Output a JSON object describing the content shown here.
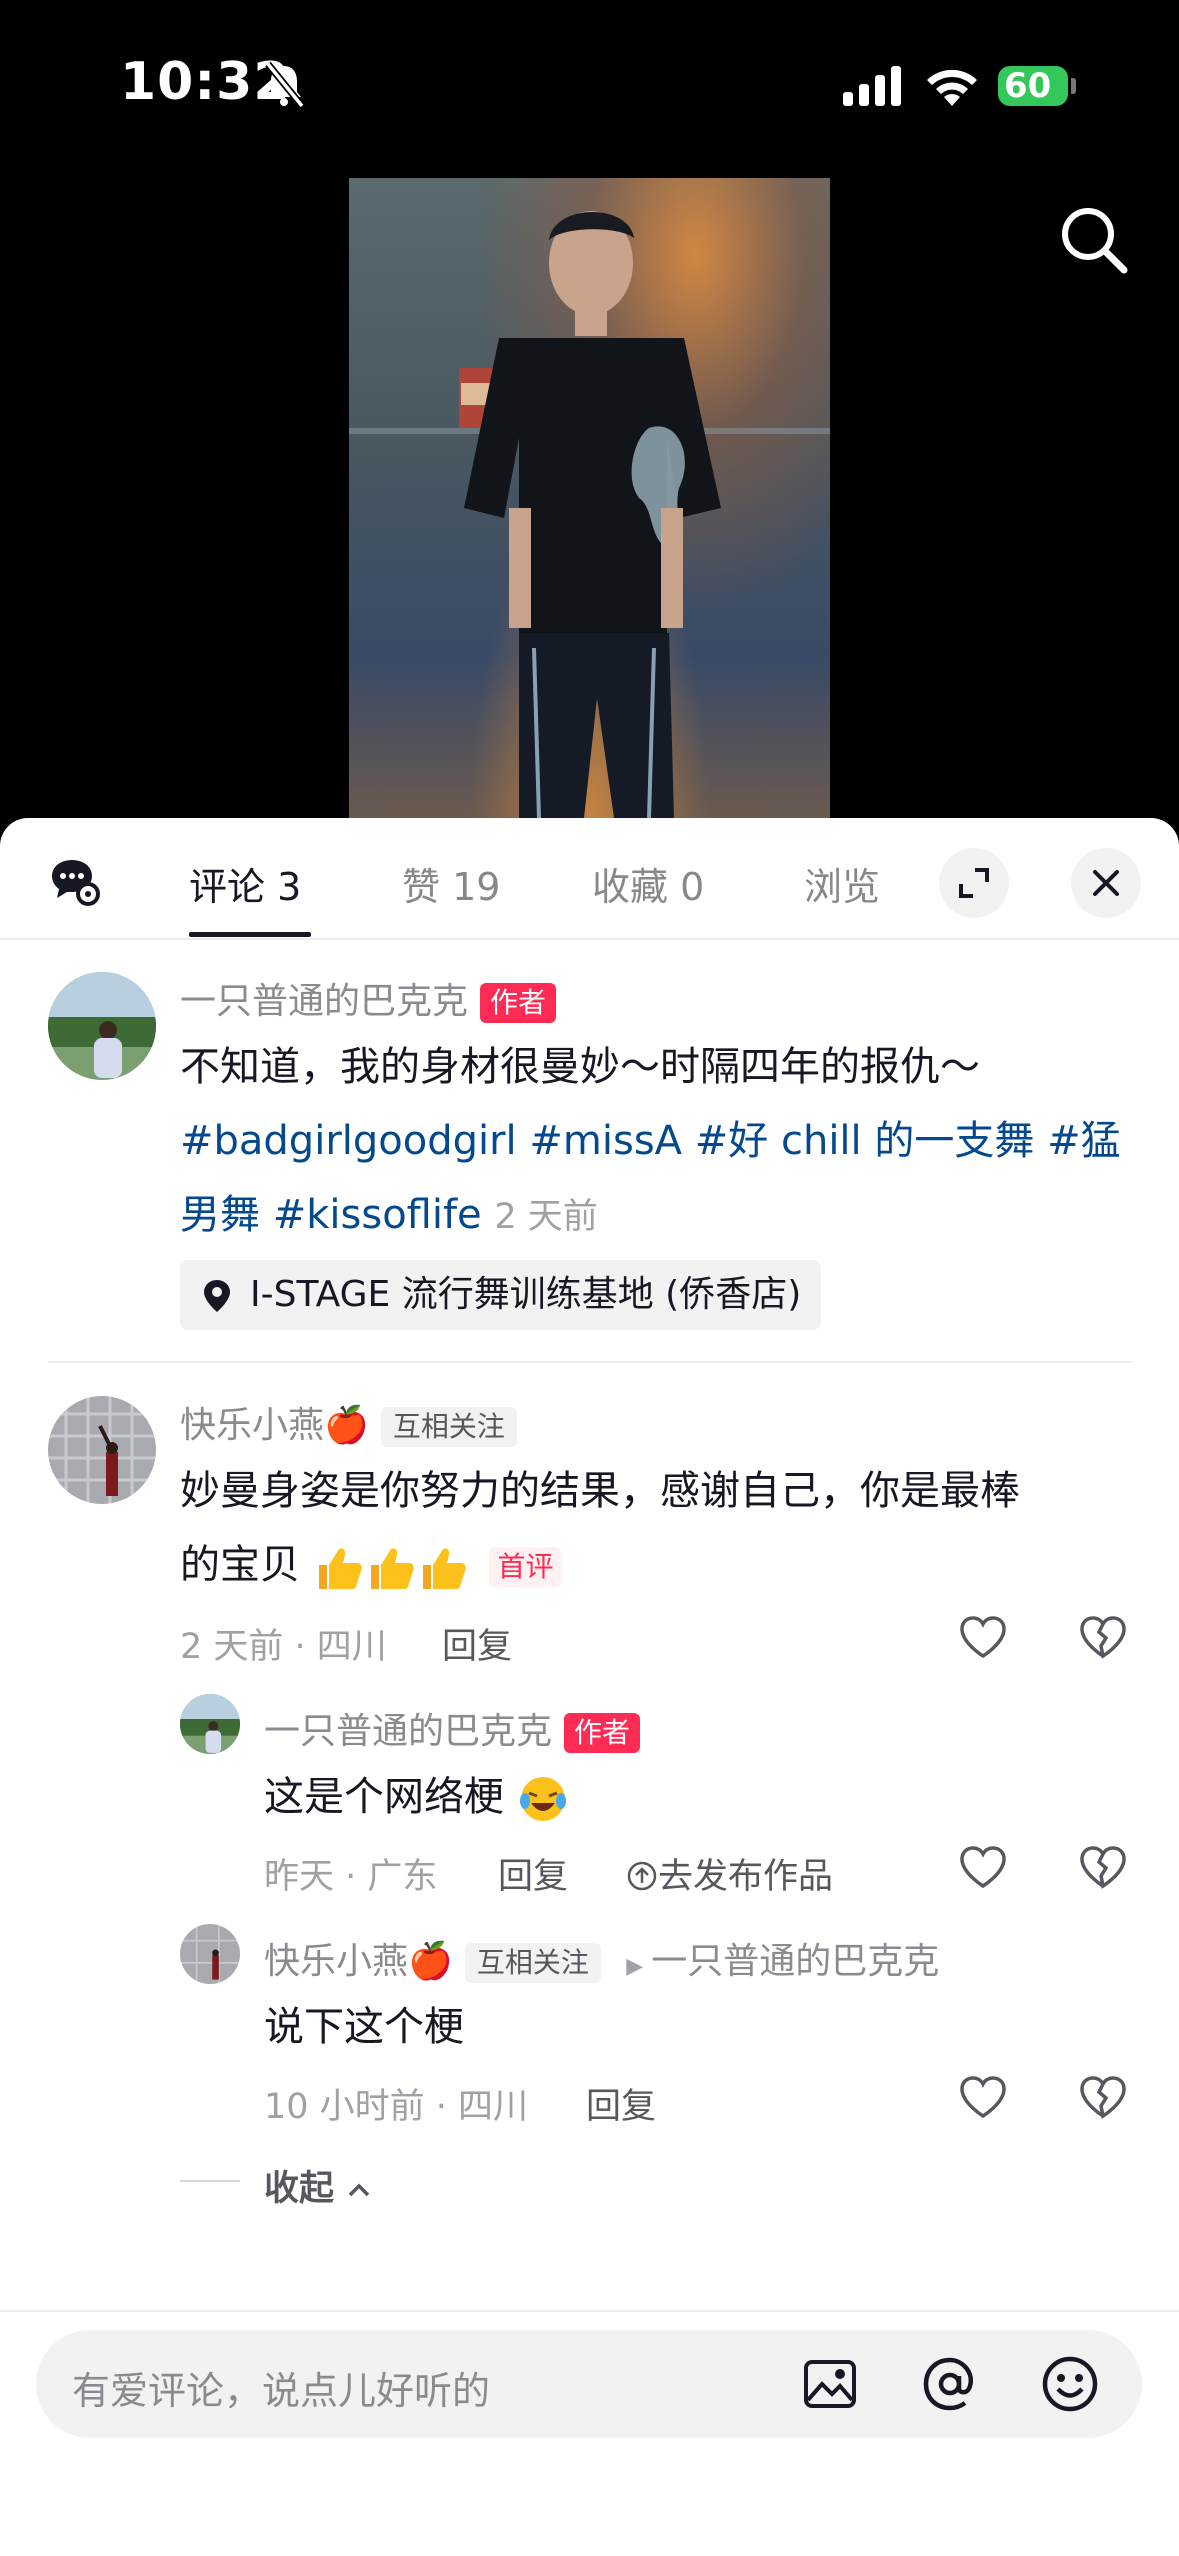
{
  "status_bar": {
    "time": "10:32",
    "battery": "60"
  },
  "tabs": [
    {
      "label": "评论 3"
    },
    {
      "label": "赞 19"
    },
    {
      "label": "收藏 0"
    },
    {
      "label": "浏览"
    }
  ],
  "post": {
    "author": "一只普通的巴克克",
    "author_tag": "作者",
    "line1": "不知道，我的身材很曼妙～时隔四年的报仇～",
    "hashtags": [
      "#badgirlgoodgirl",
      "#missA",
      "#好 chill 的一支舞",
      "#猛",
      "男舞",
      "#kissoflife"
    ],
    "time": "2 天前",
    "location": "I-STAGE 流行舞训练基地 (侨香店)"
  },
  "comment1": {
    "name": "快乐小燕🍎",
    "tag": "互相关注",
    "line1": "妙曼身姿是你努力的结果，感谢自己，你是最棒",
    "line2": "的宝贝",
    "first_tag": "首评",
    "meta": "2 天前 · 四川",
    "reply": "回复"
  },
  "reply1": {
    "name": "一只普通的巴克克",
    "tag": "作者",
    "text": "这是个网络梗",
    "meta": "昨天 · 广东",
    "reply": "回复",
    "publish": "去发布作品"
  },
  "reply2": {
    "name": "快乐小燕🍎",
    "tag": "互相关注",
    "reply_to": "一只普通的巴克克",
    "text": "说下这个梗",
    "meta": "10 小时前 · 四川",
    "reply": "回复"
  },
  "collapse": "收起",
  "input": {
    "placeholder": "有爱评论，说点儿好听的"
  },
  "colors": {
    "accent": "#fe2c55",
    "hashtag": "#04498d",
    "battery": "#34c759"
  }
}
